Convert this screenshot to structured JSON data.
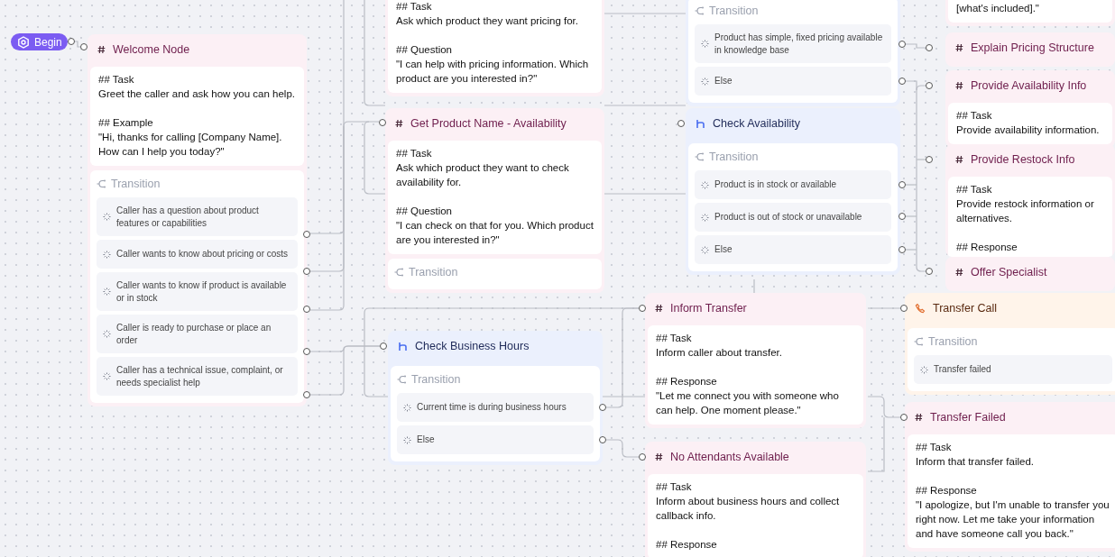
{
  "begin": {
    "label": "Begin"
  },
  "nodes": [
    {
      "kind": "conversation",
      "title": "Welcome Node",
      "prompt": "## Task\nGreet the caller and ask how you can help.\n\n## Example\n\"Hi, thanks for calling [Company Name]. How can I help you today?\"",
      "transition": {
        "label": "Transition",
        "conditions": [
          "Caller has a question about product features or capabilities",
          "Caller wants to know about pricing or costs",
          "Caller wants to know if product is available or in stock",
          "Caller is ready to purchase or place an order",
          "Caller has a technical issue, complaint, or needs specialist help"
        ]
      }
    },
    {
      "kind": "conversation",
      "prompt": "## Task\nAsk which product they want pricing for.\n\n## Question\n\"I can help with pricing information. Which product are you interested in?\""
    },
    {
      "kind": "conversation",
      "title": "Get Product Name - Availability",
      "prompt": "## Task\nAsk which product they want to check availability for.\n\n## Question\n\"I can check on that for you. Which product are you interested in?\"",
      "transition": {
        "label": "Transition"
      }
    },
    {
      "kind": "branch",
      "transition": {
        "label": "Transition",
        "conditions": [
          "Product has simple, fixed pricing available in knowledge base",
          "Else"
        ]
      }
    },
    {
      "kind": "branch",
      "title": "Check Availability",
      "transition": {
        "label": "Transition",
        "conditions": [
          "Product is in stock or available",
          "Product is out of stock or unavailable",
          "Else"
        ]
      }
    },
    {
      "kind": "conversation",
      "prompt": "[what's included].\""
    },
    {
      "kind": "conversation",
      "title": "Explain Pricing Structure"
    },
    {
      "kind": "conversation",
      "title": "Provide Availability Info",
      "prompt": "## Task\nProvide availability information."
    },
    {
      "kind": "conversation",
      "title": "Provide Restock Info",
      "prompt": "## Task\nProvide restock information or alternatives.\n\n## Response"
    },
    {
      "kind": "conversation",
      "title": "Offer Specialist"
    },
    {
      "kind": "branch",
      "title": "Check Business Hours",
      "transition": {
        "label": "Transition",
        "conditions": [
          "Current time is during business hours",
          "Else"
        ]
      }
    },
    {
      "kind": "conversation",
      "title": "Inform Transfer",
      "prompt": "## Task\nInform caller about transfer.\n\n## Response\n\"Let me connect you with someone who can help. One moment please.\""
    },
    {
      "kind": "conversation",
      "title": "No Attendants Available",
      "prompt": "## Task\nInform about business hours and collect callback info.\n\n## Response"
    },
    {
      "kind": "transfer",
      "title": "Transfer Call",
      "transition": {
        "label": "Transition",
        "conditions": [
          "Transfer failed"
        ]
      }
    },
    {
      "kind": "conversation",
      "title": "Transfer Failed",
      "prompt": "## Task\nInform that transfer failed.\n\n## Response\n\"I apologize, but I'm unable to transfer you right now. Let me take your information and have someone call you back.\""
    }
  ]
}
